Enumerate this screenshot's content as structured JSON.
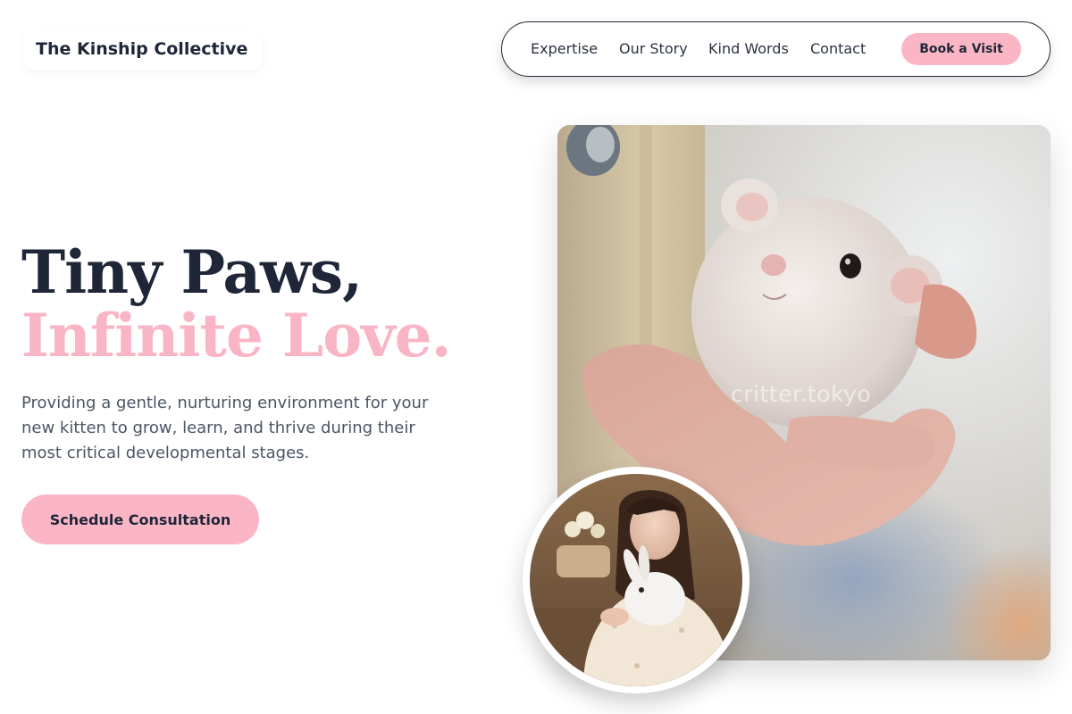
{
  "brand": {
    "name": "The Kinship Collective"
  },
  "nav": {
    "links": [
      "Expertise",
      "Our Story",
      "Kind Words",
      "Contact"
    ],
    "cta": "Book a Visit"
  },
  "hero": {
    "title_line1": "Tiny Paws,",
    "title_line2": "Infinite Love.",
    "description": "Providing a gentle, nurturing environment for your new kitten to grow, learn, and thrive during their most critical developmental stages.",
    "button": "Schedule Consultation"
  },
  "media": {
    "main_photo_watermark": "critter.tokyo"
  },
  "colors": {
    "accent_pink": "#fbb6c6",
    "title_pink": "#f9b4c5",
    "navy": "#1e2638",
    "body_text": "#4b5563"
  }
}
